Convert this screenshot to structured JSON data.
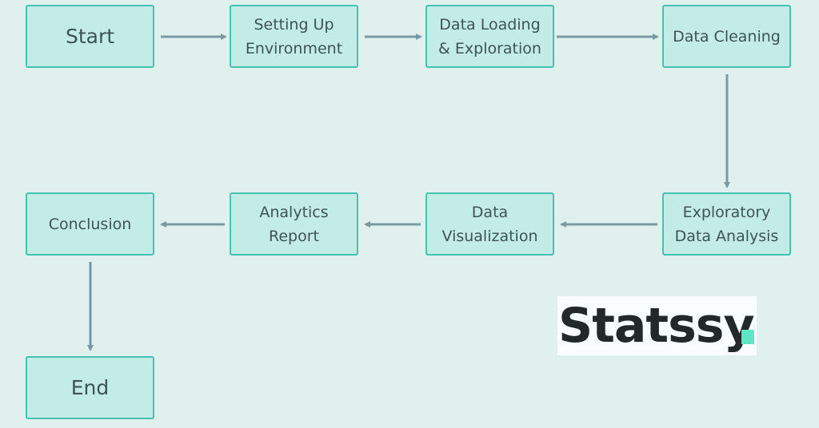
{
  "diagram": {
    "nodes": [
      {
        "id": "start",
        "label": "Start"
      },
      {
        "id": "setup",
        "label": "Setting Up\nEnvironment"
      },
      {
        "id": "loading",
        "label": "Data Loading\n& Exploration"
      },
      {
        "id": "cleaning",
        "label": "Data Cleaning"
      },
      {
        "id": "eda",
        "label": "Exploratory\nData Analysis"
      },
      {
        "id": "viz",
        "label": "Data\nVisualization"
      },
      {
        "id": "report",
        "label": "Analytics\nReport"
      },
      {
        "id": "conclusion",
        "label": "Conclusion"
      },
      {
        "id": "end",
        "label": "End"
      }
    ],
    "edges": [
      {
        "from": "start",
        "to": "setup"
      },
      {
        "from": "setup",
        "to": "loading"
      },
      {
        "from": "loading",
        "to": "cleaning"
      },
      {
        "from": "cleaning",
        "to": "eda"
      },
      {
        "from": "eda",
        "to": "viz"
      },
      {
        "from": "viz",
        "to": "report"
      },
      {
        "from": "report",
        "to": "conclusion"
      },
      {
        "from": "conclusion",
        "to": "end"
      }
    ]
  },
  "logo": {
    "text": "Statssy",
    "accent_color": "#5ee6c5"
  },
  "colors": {
    "node_fill": "#c3ece6",
    "node_border": "#45c2b0",
    "arrow": "#7a9aa1",
    "background": "#dff0ef"
  }
}
